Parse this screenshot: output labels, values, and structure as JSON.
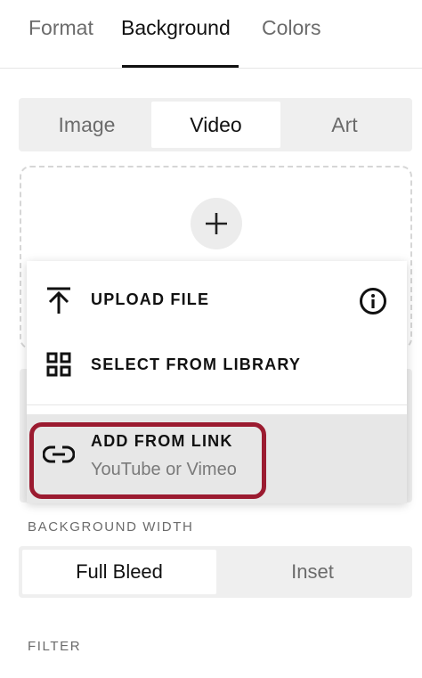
{
  "tabs": [
    {
      "label": "Format",
      "active": false
    },
    {
      "label": "Background",
      "active": true
    },
    {
      "label": "Colors",
      "active": false
    }
  ],
  "media_types": [
    {
      "label": "Image",
      "active": false
    },
    {
      "label": "Video",
      "active": true
    },
    {
      "label": "Art",
      "active": false
    }
  ],
  "add_media": {
    "icon": "plus-icon"
  },
  "menu": {
    "upload": {
      "label": "UPLOAD FILE",
      "icon": "upload-icon",
      "info_icon": "info-icon"
    },
    "library": {
      "label": "SELECT FROM LIBRARY",
      "icon": "grid-icon"
    },
    "link": {
      "label": "ADD FROM LINK",
      "subtitle": "YouTube or Vimeo",
      "icon": "link-icon",
      "highlight_color": "#9b1b30"
    }
  },
  "background_width": {
    "label": "BACKGROUND WIDTH",
    "options": [
      {
        "label": "Full Bleed",
        "active": true
      },
      {
        "label": "Inset",
        "active": false
      }
    ]
  },
  "filter": {
    "label": "FILTER"
  }
}
